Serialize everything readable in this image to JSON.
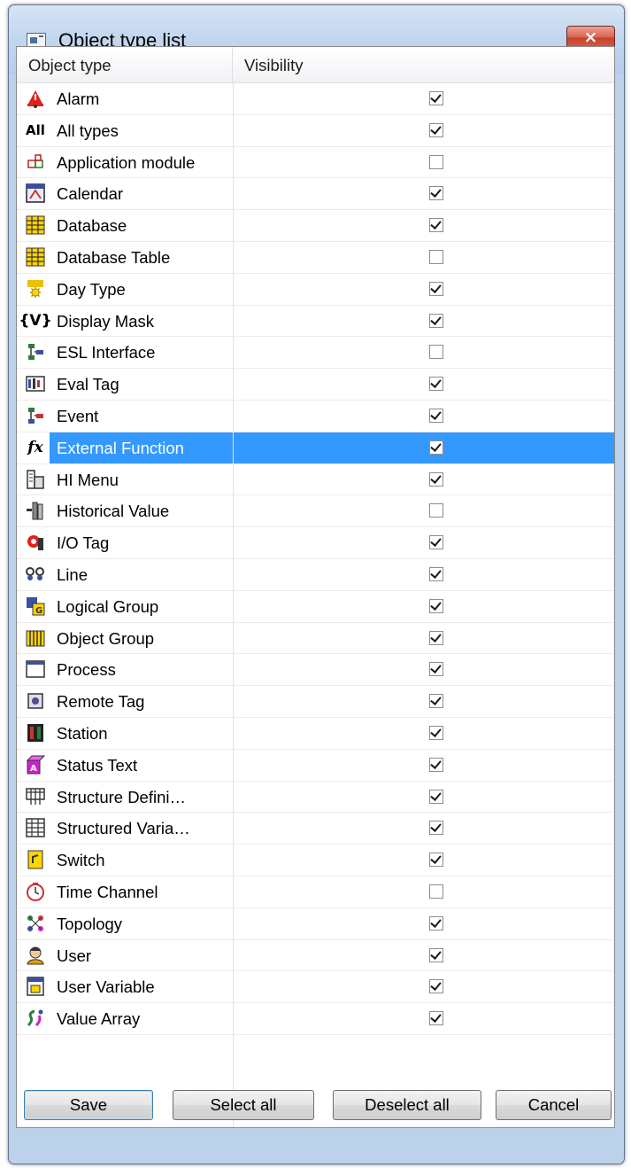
{
  "window": {
    "title": "Object type list",
    "close_glyph": "×"
  },
  "header": {
    "col_type": "Object type",
    "col_visibility": "Visibility"
  },
  "rows": [
    {
      "label": "Alarm",
      "icon": "alarm-icon",
      "checked": true
    },
    {
      "label": "All types",
      "icon": "all-types-icon",
      "checked": true
    },
    {
      "label": "Application module",
      "icon": "application-module-icon",
      "checked": false
    },
    {
      "label": "Calendar",
      "icon": "calendar-icon",
      "checked": true
    },
    {
      "label": "Database",
      "icon": "database-icon",
      "checked": true
    },
    {
      "label": "Database Table",
      "icon": "database-table-icon",
      "checked": false
    },
    {
      "label": "Day Type",
      "icon": "day-type-icon",
      "checked": true
    },
    {
      "label": "Display Mask",
      "icon": "display-mask-icon",
      "checked": true
    },
    {
      "label": "ESL Interface",
      "icon": "esl-interface-icon",
      "checked": false
    },
    {
      "label": "Eval Tag",
      "icon": "eval-tag-icon",
      "checked": true
    },
    {
      "label": "Event",
      "icon": "event-icon",
      "checked": true
    },
    {
      "label": "External Function",
      "icon": "external-function-icon",
      "checked": true,
      "selected": true
    },
    {
      "label": "HI Menu",
      "icon": "hi-menu-icon",
      "checked": true
    },
    {
      "label": "Historical Value",
      "icon": "historical-value-icon",
      "checked": false
    },
    {
      "label": "I/O Tag",
      "icon": "io-tag-icon",
      "checked": true
    },
    {
      "label": "Line",
      "icon": "line-icon",
      "checked": true
    },
    {
      "label": "Logical Group",
      "icon": "logical-group-icon",
      "checked": true
    },
    {
      "label": "Object Group",
      "icon": "object-group-icon",
      "checked": true
    },
    {
      "label": "Process",
      "icon": "process-icon",
      "checked": true
    },
    {
      "label": "Remote Tag",
      "icon": "remote-tag-icon",
      "checked": true
    },
    {
      "label": "Station",
      "icon": "station-icon",
      "checked": true
    },
    {
      "label": "Status Text",
      "icon": "status-text-icon",
      "checked": true
    },
    {
      "label": "Structure Defini…",
      "icon": "structure-definition-icon",
      "checked": true
    },
    {
      "label": "Structured Varia…",
      "icon": "structured-variable-icon",
      "checked": true
    },
    {
      "label": "Switch",
      "icon": "switch-icon",
      "checked": true
    },
    {
      "label": "Time Channel",
      "icon": "time-channel-icon",
      "checked": false
    },
    {
      "label": "Topology",
      "icon": "topology-icon",
      "checked": true
    },
    {
      "label": "User",
      "icon": "user-icon",
      "checked": true
    },
    {
      "label": "User Variable",
      "icon": "user-variable-icon",
      "checked": true
    },
    {
      "label": "Value Array",
      "icon": "value-array-icon",
      "checked": true
    }
  ],
  "icon_text": {
    "all_types": "All",
    "display_mask": "{V}",
    "external_function": "fx"
  },
  "buttons": {
    "save": "Save",
    "select_all": "Select all",
    "deselect_all": "Deselect all",
    "cancel": "Cancel"
  },
  "colors": {
    "selection": "#3399ff",
    "frame": "#bcd1ea",
    "close": "#c7412c"
  }
}
